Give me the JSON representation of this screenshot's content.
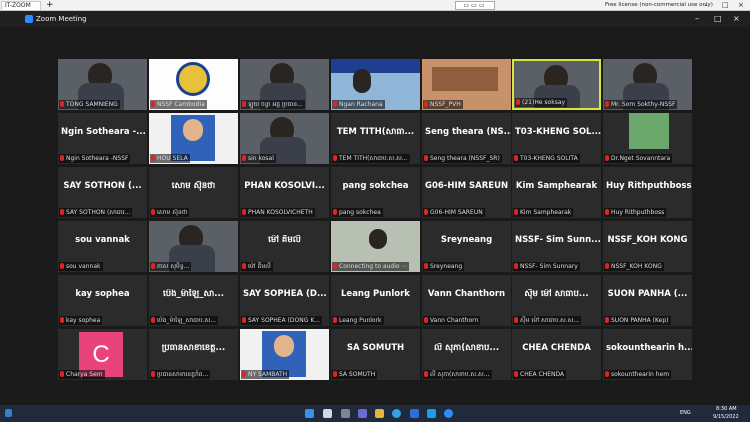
{
  "topbar": {
    "tab_label": "IT-ZOOM",
    "tab_close": "×",
    "new_tab": "+",
    "float_controls": "▭▭▭",
    "license": "Free license (non-commercial use only)",
    "minimize": "–",
    "maximize": "□",
    "close": "×"
  },
  "zoom_window": {
    "title": "Zoom Meeting",
    "minimize": "–",
    "maximize": "□",
    "close": "×"
  },
  "tiles": [
    {
      "label": "TONG SAMNIENG",
      "video": "person"
    },
    {
      "label": "NSSF Cambodia",
      "video": "logo"
    },
    {
      "label": "ឡូយ ចន្ធា អគ្គ ប្រធាន...",
      "video": "person"
    },
    {
      "label": "Ngan Rachana",
      "video": "banner"
    },
    {
      "label": "NSSF_PVH",
      "video": "room"
    },
    {
      "label": "(21)He soksay",
      "video": "person",
      "active": true
    },
    {
      "label": "Mr. Som Sokthy-NSSF",
      "video": "person"
    },
    {
      "big": "Ngin Sotheara -...",
      "label": "Ngin Sotheara -NSSF"
    },
    {
      "label": "HOU SELA",
      "video": "portrait"
    },
    {
      "label": "sin kosal",
      "video": "person"
    },
    {
      "big": "TEM TITH(សាធា...",
      "label": "TEM TITH(សាធាប.ស.ស..."
    },
    {
      "big": "Seng theara (NS...",
      "label": "Seng theara (NSSF_SR)"
    },
    {
      "big": "T03-KHENG SOL...",
      "label": "T03-KHENG SOLITA"
    },
    {
      "label": "Dr.Nget Sovanntara",
      "video": "outdoor"
    },
    {
      "big": "SAY SOTHON (...",
      "label": "SAY SOTHON (សាធារ..."
    },
    {
      "big": "សោម ស៊ុនថា",
      "label": "សោម ស៊ុនថា"
    },
    {
      "big": "PHAN KOSOLVI...",
      "label": "PHAN KOSOLVICHETH"
    },
    {
      "big": "pang sokchea",
      "label": "pang sokchea"
    },
    {
      "big": "G06-HIM SAREUN",
      "label": "G06-HIM SAREUN"
    },
    {
      "big": "Kim Samphearak",
      "label": "Kim Samphearak"
    },
    {
      "big": "Huy Rithputhboss",
      "label": "Huy Rithputhboss"
    },
    {
      "big": "sou vannak",
      "label": "sou vannak"
    },
    {
      "label": "ភាស សុមិទ្ធ...",
      "video": "person"
    },
    {
      "big": "ម៉ៅ គឹមលី",
      "label": "ម៉ៅ គឹមលី"
    },
    {
      "label": "Connecting to audio ⋯",
      "video": "office"
    },
    {
      "big": "Sreyneang",
      "label": "Sreyneang"
    },
    {
      "big": "NSSF- Sim Sunn...",
      "label": "NSSF- Sim Sunnary"
    },
    {
      "big": "NSSF_KOH KONG",
      "label": "NSSF_KOH KONG"
    },
    {
      "big": "kay sophea",
      "label": "kay sophea"
    },
    {
      "big": "ប៉េង_ម៉ាឡៃ_សា...",
      "label": "ប៉េង_ម៉ាឡៃ_សាធាប.ស..."
    },
    {
      "big": "SAY SOPHEA (D...",
      "label": "SAY SOPHEA (DONG K..."
    },
    {
      "big": "Leang Punlork",
      "label": "Leang Punlork"
    },
    {
      "big": "Vann Chanthorn",
      "label": "Vann Chanthorn"
    },
    {
      "big": "ស៊ីម ម៉ៅ សាធាប...",
      "label": "ស៊ីម ម៉ៅ សាធាប.ស.ស..."
    },
    {
      "big": "SUON PANHA (...",
      "label": "SUON PANHA (Kep)"
    },
    {
      "label": "Charya Sem",
      "video": "avatar",
      "avatar_letter": "C"
    },
    {
      "big": "ប្រធានសាខាខេត្ត...",
      "label": "ប្រធានសាខាខេត្តកំព..."
    },
    {
      "label": "NY SAMBATH",
      "video": "portrait"
    },
    {
      "big": "SA SOMUTH",
      "label": "SA SOMUTH"
    },
    {
      "big": "លី សុភា(សាខាប...",
      "label": "លី សុភា(សាខាប.ស.ស..."
    },
    {
      "big": "CHEA CHENDA",
      "label": "CHEA CHENDA"
    },
    {
      "big": "sokounthearin h...",
      "label": "sokounthearin hem"
    }
  ],
  "taskbar": {
    "lang": "ENG",
    "time": "8:30 AM",
    "date": "9/15/2022"
  },
  "colors": {
    "active_speaker": "#d7e63a",
    "muted_mic": "#e02424",
    "avatar_bg": "#e8437a",
    "zoom_blue": "#2d8cff"
  }
}
